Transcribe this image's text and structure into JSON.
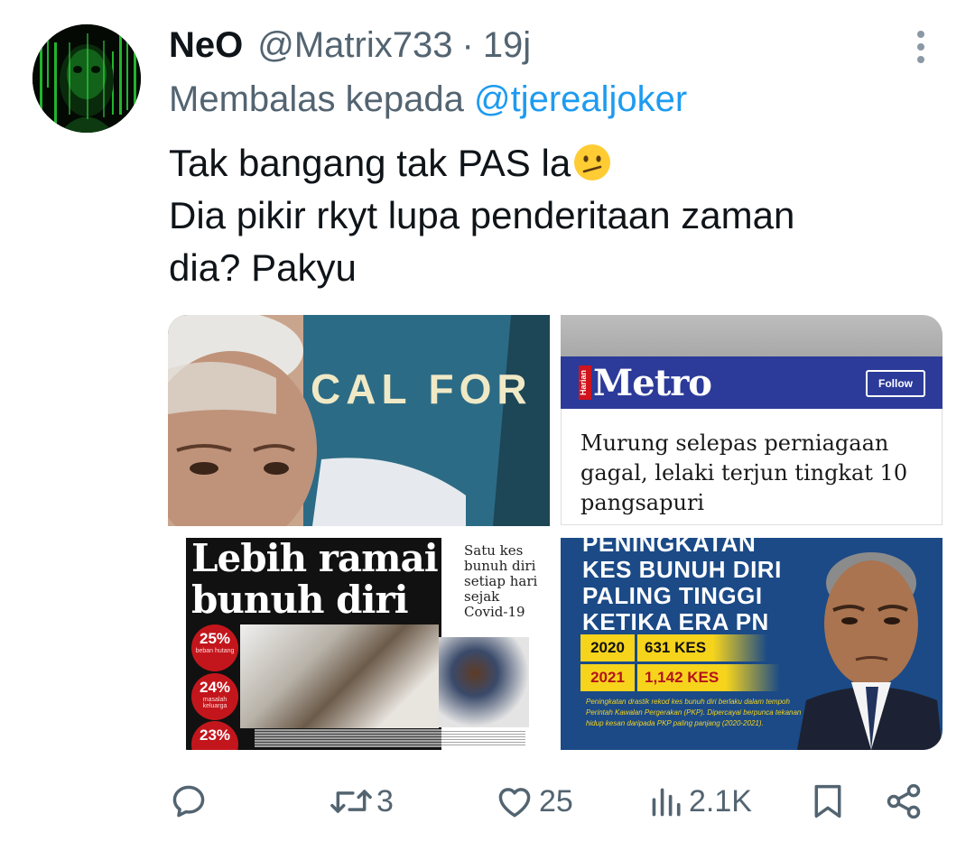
{
  "author": {
    "display_name": "NeO",
    "handle": "@Matrix733",
    "separator": "·",
    "time": "19j"
  },
  "reply": {
    "prefix": "Membalas kepada",
    "handle": "@tjerealjoker"
  },
  "tweet": {
    "line1": "Tak bangang tak PAS la",
    "line1_emoji": "confused-face-emoji",
    "line2": "Dia pikir rkyt lupa penderitaan zaman",
    "line3": "dia? Pakyu"
  },
  "media": {
    "image1": {
      "shirt_text": "CAL FOR"
    },
    "image2": {
      "harian": "Harian",
      "logo": "Metro",
      "follow_label": "Follow",
      "headline_line1": "Murung selepas perniagaan",
      "headline_line2": "gagal, lelaki terjun tingkat 10",
      "headline_line3": "pangsapuri"
    },
    "image3": {
      "title_line1": "Lebih ramai",
      "title_line2": "bunuh diri",
      "side_text": "Satu kes bunuh diri setiap hari sejak Covid-19",
      "stat1": "25%",
      "stat1_label": "beban hutang",
      "stat2": "24%",
      "stat2_label": "masalah keluarga",
      "stat3": "23%"
    },
    "image4": {
      "line1": "PENINGKATAN",
      "line2": "KES BUNUH DIRI",
      "line3": "PALING TINGGI",
      "line4": "KETIKA ERA PN",
      "row1_year": "2020",
      "row1_value": "631 KES",
      "row2_year": "2021",
      "row2_value": "1,142 KES",
      "caption": "Peningkatan drastik rekod kes bunuh diri berlaku dalam tempoh Perintah Kawalan Pergerakan (PKP). Dipercayai berpunca tekanan hidup kesan daripada PKP paling panjang (2020-2021)."
    }
  },
  "actions": {
    "reply_count": "",
    "retweet_count": "3",
    "like_count": "25",
    "views_count": "2.1K",
    "icons": [
      "reply-icon",
      "retweet-icon",
      "like-icon",
      "views-icon",
      "bookmark-icon",
      "share-icon",
      "more-icon"
    ]
  },
  "colors": {
    "link": "#1d9bf0",
    "secondary_text": "#536471",
    "metro_blue": "#2c3b99",
    "pn_blue": "#1b4a87",
    "pn_yellow": "#f6d41c",
    "np_red": "#c3161c"
  }
}
